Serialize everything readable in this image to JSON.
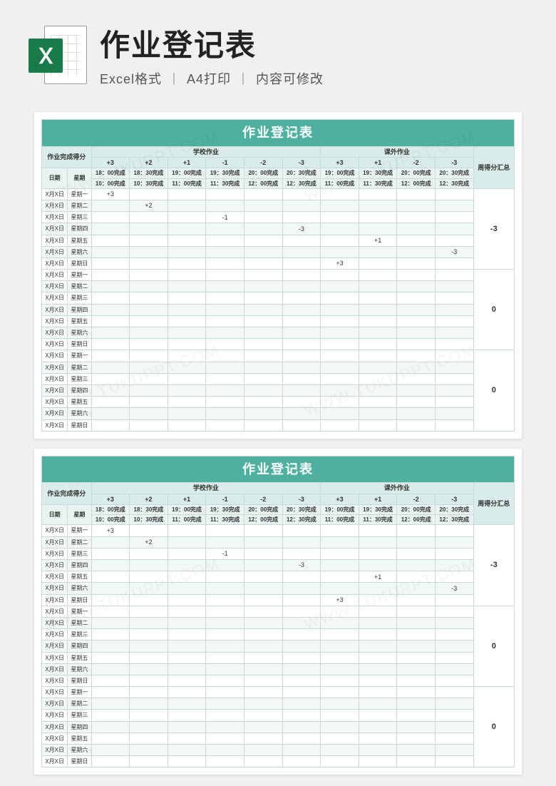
{
  "header": {
    "title": "作业登记表",
    "sub1": "Excel格式",
    "sub2": "A4打印",
    "sub3": "内容可修改",
    "sep": "丨",
    "icon_letter": "X"
  },
  "sheet": {
    "title": "作业登记表",
    "merge_label": "作业完成得分",
    "group1": "学校作业",
    "group2": "课外作业",
    "total_label": "周得分汇总",
    "date_label": "日期",
    "week_label": "星期",
    "scores_school": [
      "+3",
      "+2",
      "+1",
      "-1",
      "-2",
      "-3"
    ],
    "scores_extra": [
      "+3",
      "+1",
      "-2",
      "-3"
    ],
    "times_school_a": [
      "18：00完成",
      "18：30完成",
      "19：00完成",
      "19：30完成",
      "20：00完成",
      "20：30完成"
    ],
    "times_extra_a": [
      "19：00完成",
      "19：30完成",
      "20：00完成",
      "20：30完成"
    ],
    "times_school_b": [
      "10：00完成",
      "10：30完成",
      "11：00完成",
      "11：30完成",
      "12：00完成",
      "12：30完成"
    ],
    "times_extra_b": [
      "11：00完成",
      "11：30完成",
      "12：00完成",
      "12：30完成"
    ],
    "date_cell": "X月X日",
    "weekdays": [
      "星期一",
      "星期二",
      "星期三",
      "星期四",
      "星期五",
      "星期六",
      "星期日"
    ],
    "week1": {
      "total": "-3",
      "marks": [
        {
          "row": 0,
          "col": 0,
          "val": "+3"
        },
        {
          "row": 1,
          "col": 1,
          "val": "+2"
        },
        {
          "row": 2,
          "col": 3,
          "val": "-1"
        },
        {
          "row": 3,
          "col": 5,
          "val": "-3"
        },
        {
          "row": 4,
          "col": 7,
          "val": "+1"
        },
        {
          "row": 5,
          "col": 9,
          "val": "-3"
        },
        {
          "row": 6,
          "col": 6,
          "val": "+3"
        }
      ]
    },
    "week2": {
      "total": "0",
      "marks": []
    },
    "week3": {
      "total": "0",
      "marks": []
    }
  },
  "watermark": "WWW.TUKUPPT.COM"
}
